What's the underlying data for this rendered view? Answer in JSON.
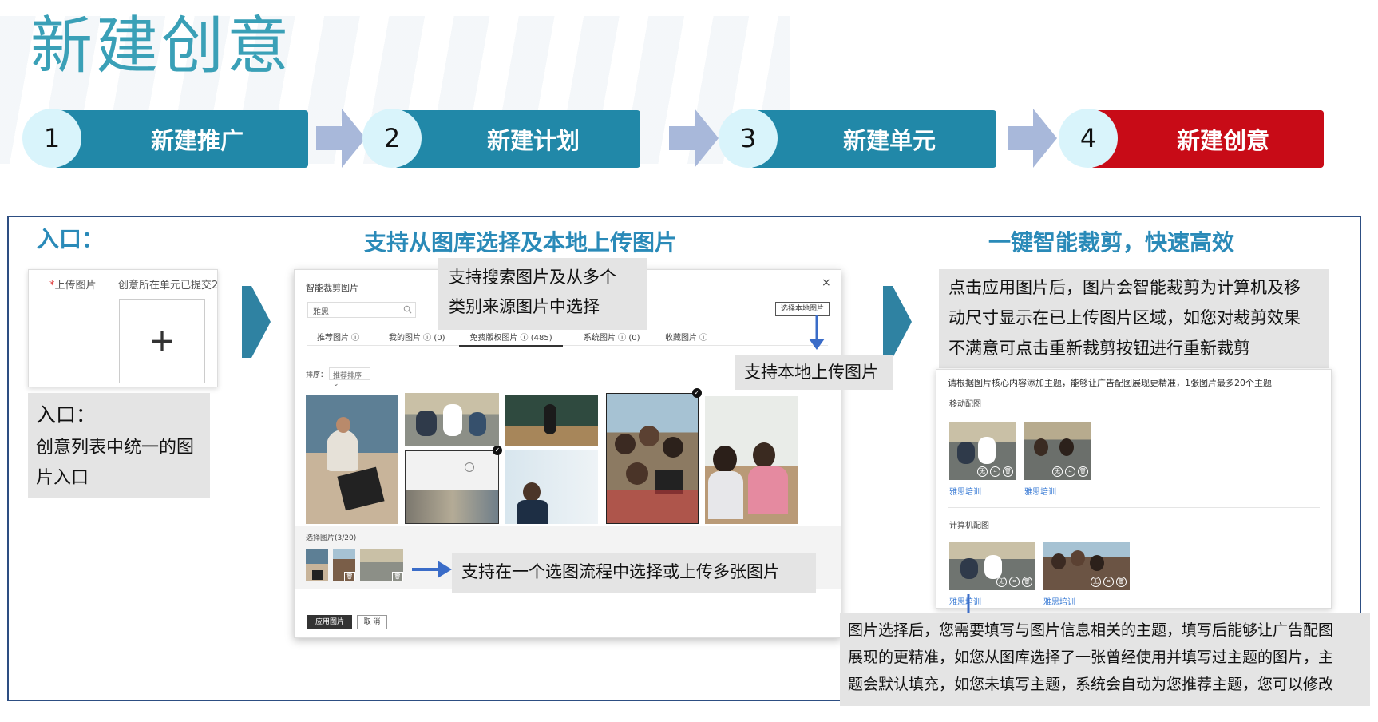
{
  "page": {
    "title": "新建创意"
  },
  "steps": [
    {
      "number": "1",
      "label": "新建推广"
    },
    {
      "number": "2",
      "label": "新建计划"
    },
    {
      "number": "3",
      "label": "新建单元"
    },
    {
      "number": "4",
      "label": "新建创意"
    }
  ],
  "section": {
    "entry_heading": "入口：",
    "library_heading": "支持从图库选择及本地上传图片",
    "crop_heading": "一键智能裁剪，快速高效"
  },
  "upload_panel": {
    "label_required": "*",
    "label": "上传图片",
    "hint": "创意所在单元已提交2",
    "plus": "+"
  },
  "entry_note": {
    "title": "入口：",
    "line1": "创意列表中统一的图",
    "line2": "片入口"
  },
  "dialog": {
    "title": "智能裁剪图片",
    "close": "×",
    "search_value": "雅思",
    "search_icon": "search-icon",
    "local_upload_button": "选择本地图片",
    "tabs": [
      {
        "label": "推荐图片 ⓘ"
      },
      {
        "label": "我的图片 ⓘ (0)"
      },
      {
        "label": "免费版权图片 ⓘ (485)"
      },
      {
        "label": "系统图片 ⓘ (0)"
      },
      {
        "label": "收藏图片 ⓘ"
      }
    ],
    "sort_label": "排序：",
    "sort_value": "推荐排序 ⌄",
    "selected_label": "选择图片(3/20)",
    "apply_button": "应用图片",
    "cancel_button": "取 消",
    "trash_icon": "trash-icon",
    "check_icon": "check-icon"
  },
  "callouts": {
    "search_multi": {
      "line1": "支持搜索图片及从多个",
      "line2": "类别来源图片中选择"
    },
    "local_upload": "支持本地上传图片",
    "multi_select": "支持在一个选图流程中选择或上传多张图片",
    "crop_desc": {
      "line1": "点击应用图片后，图片会智能裁剪为计算机及移",
      "line2": "动尺寸显示在已上传图片区域，如您对裁剪效果",
      "line3": "不满意可点击重新裁剪按钮进行重新裁剪"
    },
    "topic_desc": {
      "line1": "图片选择后，您需要填写与图片信息相关的主题，填写后能够让广告配图",
      "line2": "展现的更精准，如您从图库选择了一张曾经使用并填写过主题的图片，主",
      "line3": "题会默认填充，如您未填写主题，系统会自动为您推荐主题，您可以修改"
    }
  },
  "preview": {
    "instruction": "请根据图片核心内容添加主题，能够让广告配图展现更精准，1张图片最多20个主题",
    "mobile_label": "移动配图",
    "desktop_label": "计算机配图",
    "image_topic": "雅思培训",
    "tool_none": "无",
    "tool_crop": "⌗",
    "tool_delete": "🗑"
  },
  "colors": {
    "title": "#3aa0b7",
    "step_blue": "#2188a8",
    "step_red": "#c80b17",
    "heading": "#2a8ab8",
    "frame": "#2d4e82",
    "arrow_blue": "#3a6cc8",
    "chevron": "#2f82a2",
    "step_arrow": "#a8b8da"
  }
}
